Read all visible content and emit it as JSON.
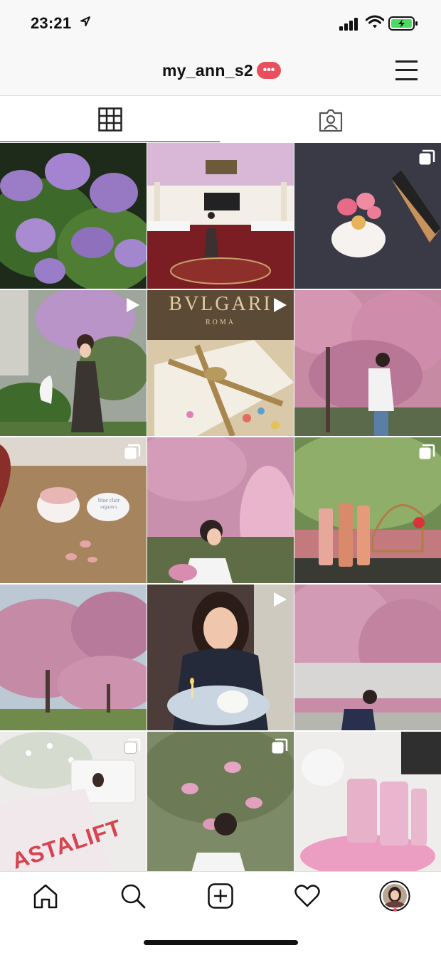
{
  "status_bar": {
    "time": "23:21"
  },
  "header": {
    "username": "my_ann_s2",
    "badge": "•••"
  },
  "tabs": [
    {
      "name": "grid-view"
    },
    {
      "name": "tagged-view"
    }
  ],
  "posts": [
    {
      "subject": "lilac flowers",
      "type": "photo",
      "bg": "#5a7a3a"
    },
    {
      "subject": "ballroom",
      "type": "photo",
      "bg": "#b6857e"
    },
    {
      "subject": "dessert on plate",
      "type": "carousel",
      "bg": "#3b3b45"
    },
    {
      "subject": "woman with lilacs",
      "type": "video",
      "bg": "#6f7f63"
    },
    {
      "subject": "BVLGARI gift box",
      "type": "video",
      "bg": "#c9ab80",
      "label": "BVLGARI",
      "sublabel": "ROMA"
    },
    {
      "subject": "cherry blossom tree",
      "type": "photo",
      "bg": "#b96f8f"
    },
    {
      "subject": "capsules on rattan",
      "type": "carousel",
      "bg": "#a88460",
      "label": "blue clair",
      "sublabel": "organics"
    },
    {
      "subject": "woman under blossoms",
      "type": "photo",
      "bg": "#c78ca8"
    },
    {
      "subject": "skincare bottles",
      "type": "carousel",
      "bg": "#7a8f5a"
    },
    {
      "subject": "cherry blossom park",
      "type": "photo",
      "bg": "#b97e98"
    },
    {
      "subject": "birthday cake",
      "type": "video",
      "bg": "#4a3a38"
    },
    {
      "subject": "woman under blossoms 2",
      "type": "photo",
      "bg": "#c98aa4"
    },
    {
      "subject": "ASTALIFT package",
      "type": "carousel",
      "bg": "#e4e2e0",
      "label": "ASTALIFT"
    },
    {
      "subject": "magnolia",
      "type": "carousel",
      "bg": "#7e8a66"
    },
    {
      "subject": "pink bottles",
      "type": "photo",
      "bg": "#e4b7cc"
    }
  ],
  "nav": [
    {
      "name": "home"
    },
    {
      "name": "search"
    },
    {
      "name": "new-post"
    },
    {
      "name": "activity"
    },
    {
      "name": "profile"
    }
  ],
  "colors": {
    "accent": "#e94f5c",
    "bar_bg": "#f8f8f8",
    "battery_fill": "#4cd964"
  }
}
